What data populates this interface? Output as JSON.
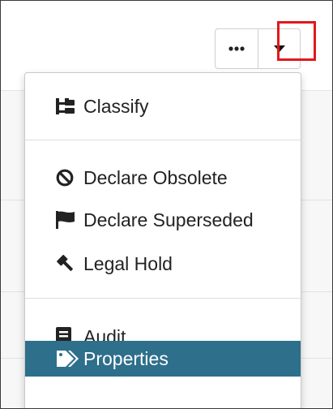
{
  "toolbar": {
    "more_icon": "ellipsis-icon",
    "caret_icon": "caret-down-icon",
    "highlight_color": "#e0191c"
  },
  "menu": {
    "items": [
      {
        "label": "Classify",
        "icon": "sitemap-icon"
      },
      {
        "label": "Declare Obsolete",
        "icon": "ban-icon"
      },
      {
        "label": "Declare Superseded",
        "icon": "flag-icon"
      },
      {
        "label": "Legal Hold",
        "icon": "gavel-icon"
      },
      {
        "label": "Audit",
        "icon": "book-icon"
      },
      {
        "label": "Properties",
        "icon": "tags-icon",
        "active": true
      }
    ],
    "active_color": "#2e6f8b"
  }
}
